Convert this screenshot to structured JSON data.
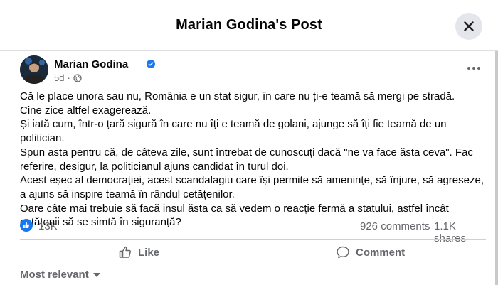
{
  "dialog": {
    "title": "Marian Godina's Post"
  },
  "post": {
    "author": "Marian Godina",
    "time": "5d",
    "paragraphs": [
      "Că le place unora sau nu, România e un stat sigur, în care nu ți-e teamă să mergi pe stradă.",
      "Cine zice altfel exagerează.",
      "Și iată cum, într-o țară sigură în care nu îți e teamă de golani, ajunge să îți fie teamă de un politician.",
      "Spun asta pentru că, de câteva zile, sunt întrebat de cunoscuți dacă \"ne va face ăsta ceva\". Fac referire, desigur, la politicianul ajuns candidat în turul doi.",
      "Acest eșec al democrației, acest scandalagiu care își permite să amenințe, să înjure, să agreseze, a ajuns să inspire teamă în rândul cetățenilor.",
      "Oare câte mai trebuie să facă insul ăsta ca să vedem o reacție fermă a statului, astfel încât cetățenii să se simtă în siguranță?"
    ]
  },
  "stats": {
    "reactions": "13K",
    "comments": "926 comments",
    "shares": "1.1K shares"
  },
  "actions": {
    "like_label": "Like",
    "comment_label": "Comment"
  },
  "comments_section": {
    "sort_label": "Most relevant"
  },
  "icons": {
    "close": "close-icon",
    "verified": "verified-badge-icon",
    "audience": "globe-icon",
    "more": "more-options-icon",
    "reaction": "thumbs-up-icon",
    "like": "like-icon",
    "comment": "comment-icon",
    "sort": "chevron-down-icon"
  },
  "colors": {
    "accent": "#1877f2",
    "secondary_text": "#65676b",
    "button_bg": "#e4e6eb"
  }
}
